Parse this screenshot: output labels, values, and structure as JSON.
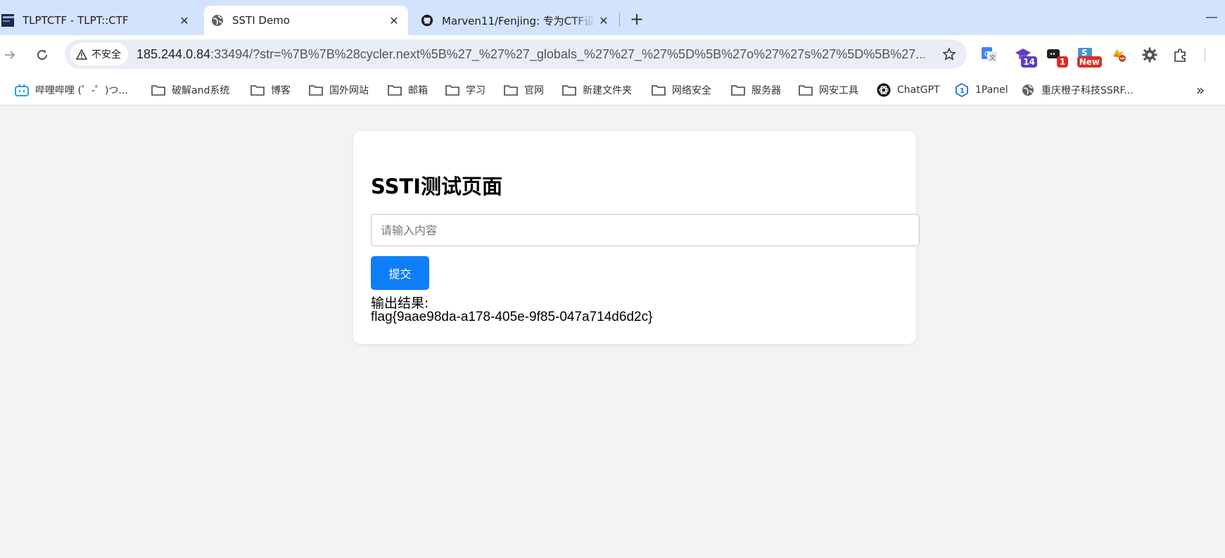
{
  "tabs": [
    {
      "title": "TLPTCTF - TLPT::CTF",
      "active": false,
      "favicon": "tlpt-favicon-icon"
    },
    {
      "title": "SSTI Demo",
      "active": true,
      "favicon": "globe-icon"
    },
    {
      "title": "Marven11/Fenjing: 专为CTF设",
      "active": false,
      "favicon": "github-icon"
    }
  ],
  "toolbar": {
    "security_label": "不安全",
    "url_host": "185.244.0.84",
    "url_rest": ":33494/?str=%7B%7B%28cycler.next%5B%27_%27%27_globals_%27%27_%27%5D%5B%27o%27%27s%27%5D%5B%27...",
    "extensions": [
      {
        "icon": "google-translate-icon"
      },
      {
        "icon": "graduation-cap-icon",
        "badge": "14",
        "badge_color": "#5b3fbf"
      },
      {
        "icon": "chat-bubble-icon",
        "badge": "1",
        "badge_color": "#d93025"
      },
      {
        "icon": "s-extension-icon",
        "badge": "New",
        "badge_color": "#d93025"
      },
      {
        "icon": "blocked-extension-icon"
      },
      {
        "icon": "gear-icon"
      },
      {
        "icon": "puzzle-icon"
      }
    ]
  },
  "bookmarks": [
    {
      "label": "哔哩哔哩 (゜-゜)つ...",
      "icon": "bilibili-icon"
    },
    {
      "label": "破解and系统",
      "icon": "folder-icon"
    },
    {
      "label": "博客",
      "icon": "folder-icon"
    },
    {
      "label": "国外网站",
      "icon": "folder-icon"
    },
    {
      "label": "邮箱",
      "icon": "folder-icon"
    },
    {
      "label": "学习",
      "icon": "folder-icon"
    },
    {
      "label": "官网",
      "icon": "folder-icon"
    },
    {
      "label": "新建文件夹",
      "icon": "folder-icon"
    },
    {
      "label": "网络安全",
      "icon": "folder-icon"
    },
    {
      "label": "服务器",
      "icon": "folder-icon"
    },
    {
      "label": "网安工具",
      "icon": "folder-icon"
    },
    {
      "label": "ChatGPT",
      "icon": "chatgpt-icon"
    },
    {
      "label": "1Panel",
      "icon": "1panel-icon"
    },
    {
      "label": "重庆橙子科技SSRF...",
      "icon": "globe-icon"
    }
  ],
  "page": {
    "heading": "SSTI测试页面",
    "input_placeholder": "请输入内容",
    "input_value": "",
    "submit_label": "提交",
    "output_label": "输出结果:",
    "output_value": "flag{9aae98da-a178-405e-9f85-047a714d6d2c}"
  },
  "colors": {
    "tabstrip": "#d3e3fd",
    "submit_button": "#0d7ef8",
    "page_background": "#f3f3f3"
  }
}
